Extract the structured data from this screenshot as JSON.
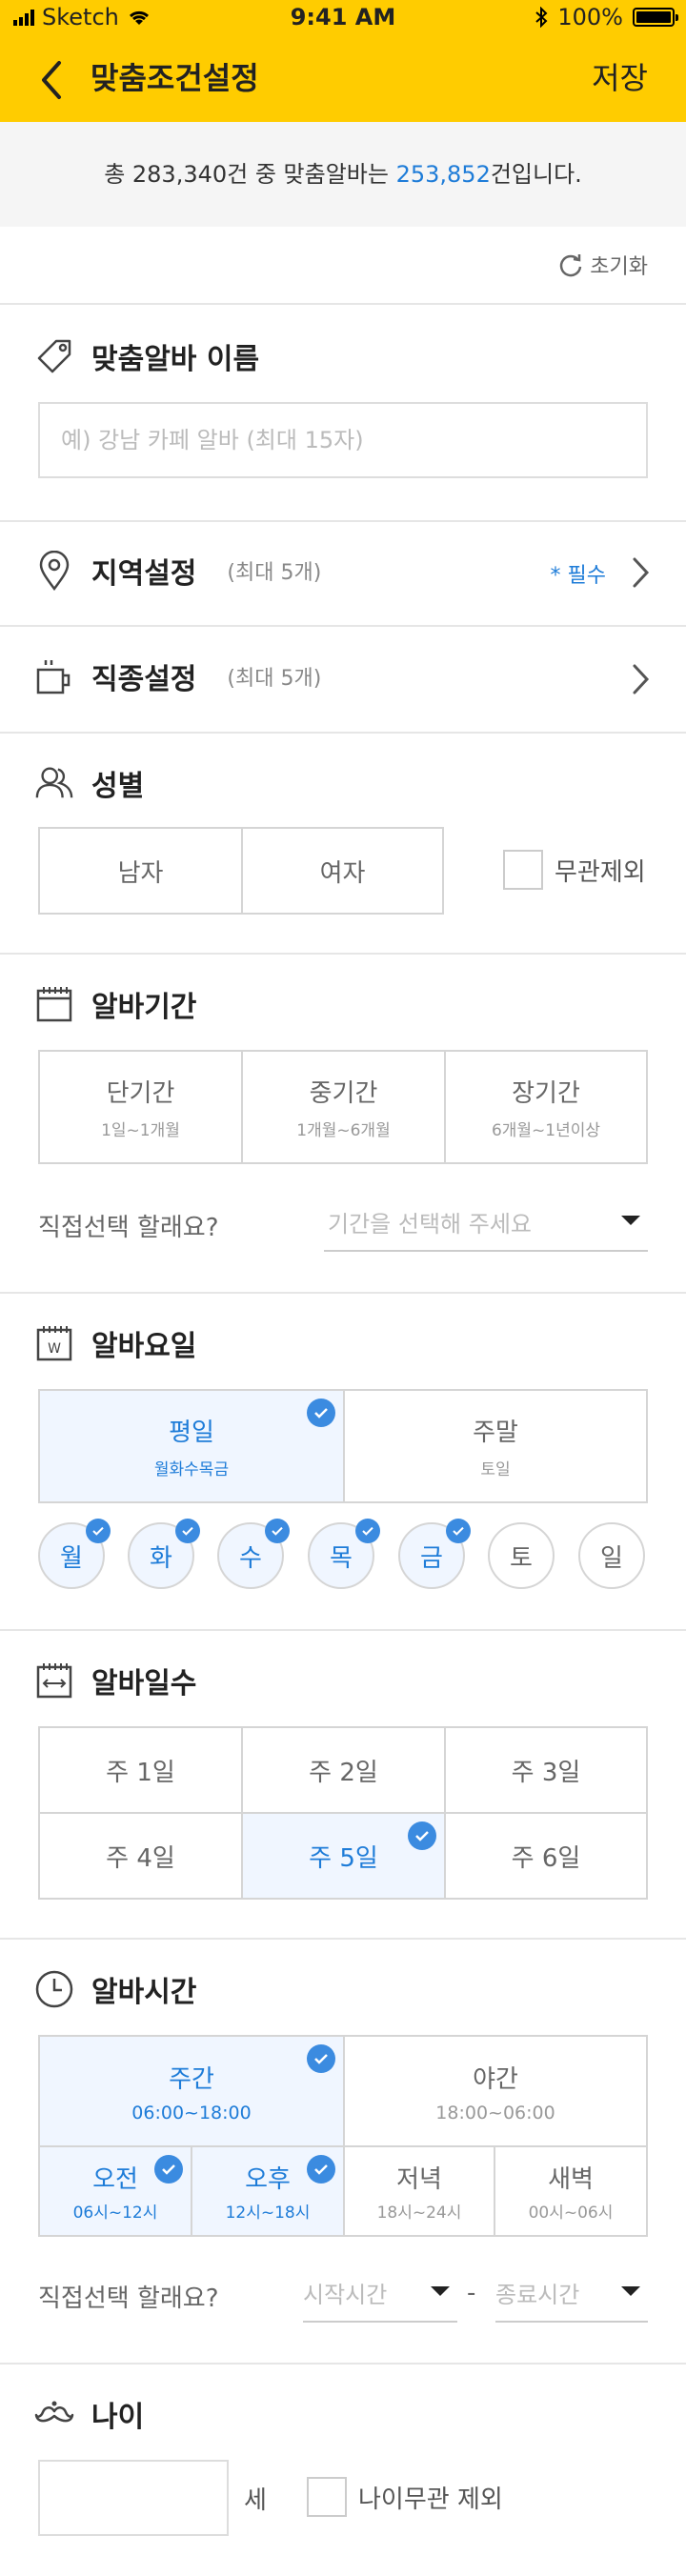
{
  "status_bar": {
    "carrier": "Sketch",
    "time": "9:41 AM",
    "battery": "100%"
  },
  "header": {
    "title": "맞춤조건설정",
    "save_label": "저장"
  },
  "summary": {
    "prefix": "총 283,340건 중 맞춤알바는 ",
    "count": "253,852",
    "suffix": "건입니다."
  },
  "reset_label": "초기화",
  "name_section": {
    "title": "맞춤알바 이름",
    "placeholder": "예) 강남 카페 알바 (최대 15자)"
  },
  "region_section": {
    "title": "지역설정",
    "sub": "(최대 5개)",
    "required": "* 필수"
  },
  "job_section": {
    "title": "직종설정",
    "sub": "(최대 5개)"
  },
  "gender_section": {
    "title": "성별",
    "options": [
      "남자",
      "여자"
    ],
    "any_label": "무관제외"
  },
  "period_section": {
    "title": "알바기간",
    "options": [
      {
        "label": "단기간",
        "sub": "1일~1개월"
      },
      {
        "label": "중기간",
        "sub": "1개월~6개월"
      },
      {
        "label": "장기간",
        "sub": "6개월~1년이상"
      }
    ],
    "direct_label": "직접선택 할래요?",
    "direct_placeholder": "기간을 선택해 주세요"
  },
  "weekday_section": {
    "title": "알바요일",
    "options": [
      {
        "label": "평일",
        "sub": "월화수목금",
        "selected": true
      },
      {
        "label": "주말",
        "sub": "토일",
        "selected": false
      }
    ],
    "days": [
      "월",
      "화",
      "수",
      "목",
      "금",
      "토",
      "일"
    ],
    "days_selected": [
      true,
      true,
      true,
      true,
      true,
      false,
      false
    ]
  },
  "daycount_section": {
    "title": "알바일수",
    "options": [
      "주 1일",
      "주 2일",
      "주 3일",
      "주 4일",
      "주 5일",
      "주 6일"
    ],
    "selected_index": 4
  },
  "time_section": {
    "title": "알바시간",
    "main": [
      {
        "label": "주간",
        "sub": "06:00~18:00",
        "selected": true
      },
      {
        "label": "야간",
        "sub": "18:00~06:00",
        "selected": false
      }
    ],
    "slots": [
      {
        "label": "오전",
        "sub": "06시~12시",
        "selected": true
      },
      {
        "label": "오후",
        "sub": "12시~18시",
        "selected": true
      },
      {
        "label": "저녁",
        "sub": "18시~24시",
        "selected": false
      },
      {
        "label": "새벽",
        "sub": "00시~06시",
        "selected": false
      }
    ],
    "direct_label": "직접선택 할래요?",
    "start_placeholder": "시작시간",
    "dash": "-",
    "end_placeholder": "종료시간"
  },
  "age_section": {
    "title": "나이",
    "unit": "세",
    "any_label": "나이무관 제외"
  },
  "colors": {
    "brand": "#FFCC00",
    "accent": "#1E7CD8",
    "selected_bg": "#F0F6FF"
  }
}
